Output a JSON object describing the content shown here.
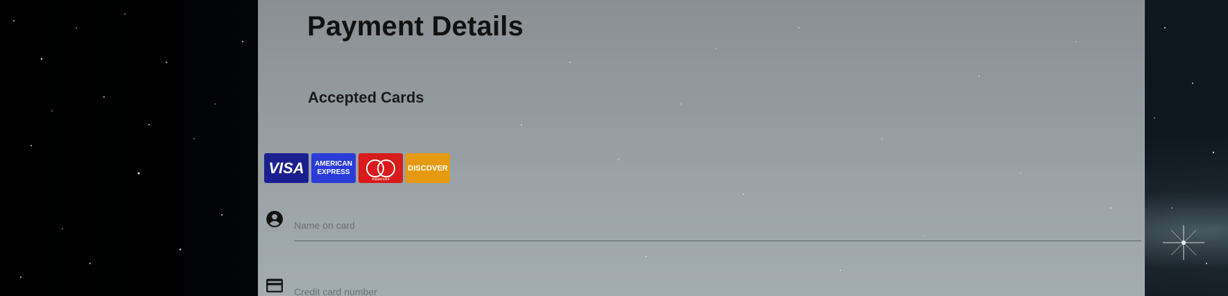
{
  "page": {
    "title": "Payment Details",
    "accepted_cards_label": "Accepted Cards"
  },
  "cards": {
    "visa": "VISA",
    "amex_line1": "AMERICAN",
    "amex_line2": "EXPRESS",
    "mastercard": "mastercard",
    "discover": "DISCOVER"
  },
  "form": {
    "name_placeholder": "Name on card",
    "card_number_placeholder": "Credit card number"
  },
  "icons": {
    "name": "account-circle-icon",
    "card": "credit-card-icon"
  }
}
